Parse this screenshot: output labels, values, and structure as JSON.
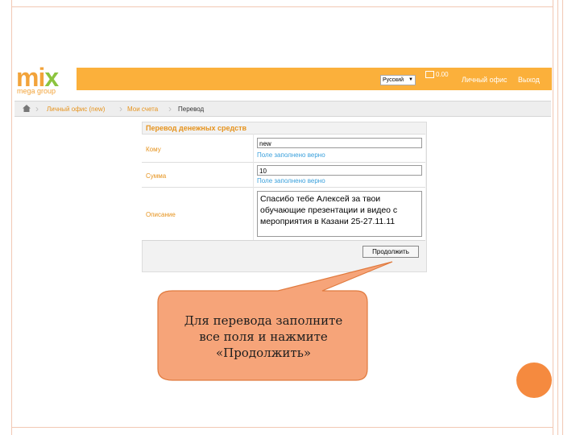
{
  "logo": {
    "brand_main": "mi",
    "brand_x": "x",
    "brand_sub": "mega group"
  },
  "header": {
    "language": "Русский",
    "balance": "0.00",
    "office_link": "Личный офис",
    "logout_link": "Выход"
  },
  "breadcrumb": {
    "items": [
      "Личный офис (new)",
      "Мои счета",
      "Перевод"
    ]
  },
  "form": {
    "title": "Перевод денежных средств",
    "fields": [
      {
        "label": "Кому",
        "value": "new",
        "hint": "Поле заполнено верно"
      },
      {
        "label": "Сумма",
        "value": "10",
        "hint": "Поле заполнено верно"
      },
      {
        "label": "Описание",
        "lines": [
          "Спасибо тебе Алексей за твои",
          "обучающие презентации и видео с",
          "мероприятия в Казани 25-27.11.11"
        ]
      }
    ],
    "submit_label": "Продолжить"
  },
  "callout": {
    "lines": [
      "Для перевода заполните",
      "все поля и нажмите",
      "«Продолжить»"
    ]
  },
  "colors": {
    "header_orange": "#fbb03b",
    "label_orange": "#e6931d",
    "hint_blue": "#3aa0dc",
    "callout_fill": "#f6a479",
    "deco_circle": "#f58a3f"
  }
}
